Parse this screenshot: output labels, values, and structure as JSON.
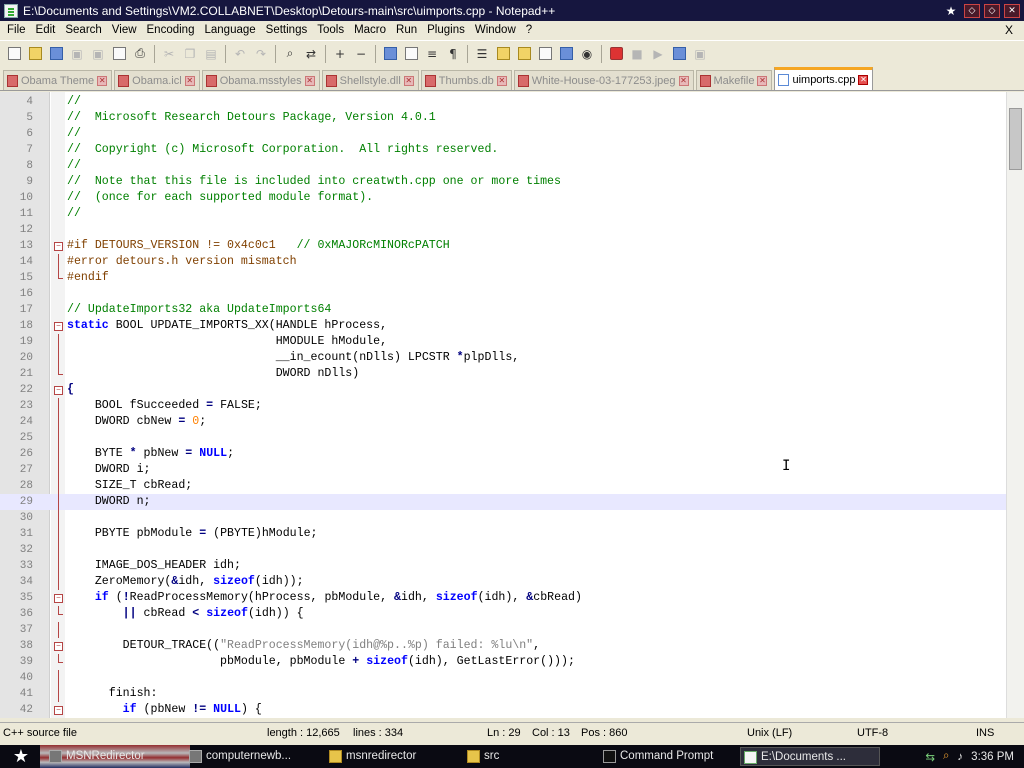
{
  "window": {
    "title": "E:\\Documents and Settings\\VM2.COLLABNET\\Desktop\\Detours-main\\src\\uimports.cpp - Notepad++",
    "controls": [
      "★",
      "◇",
      "◇",
      "✕"
    ]
  },
  "menu": [
    "File",
    "Edit",
    "Search",
    "View",
    "Encoding",
    "Language",
    "Settings",
    "Tools",
    "Macro",
    "Run",
    "Plugins",
    "Window",
    "?"
  ],
  "menu_close": "X",
  "tabs": [
    {
      "label": "Obama Theme",
      "active": false
    },
    {
      "label": "Obama.icl",
      "active": false
    },
    {
      "label": "Obama.msstyles",
      "active": false
    },
    {
      "label": "Shellstyle.dll",
      "active": false
    },
    {
      "label": "Thumbs.db",
      "active": false
    },
    {
      "label": "White-House-03-177253.jpeg",
      "active": false
    },
    {
      "label": "Makefile",
      "active": false
    },
    {
      "label": "uimports.cpp",
      "active": true
    }
  ],
  "status": {
    "file_type": "C++ source file",
    "length": "length : 12,665",
    "lines": "lines : 334",
    "ln": "Ln : 29",
    "col": "Col : 13",
    "pos": "Pos : 860",
    "eol": "Unix (LF)",
    "encoding": "UTF-8",
    "mode": "INS"
  },
  "taskbar": {
    "tasks": [
      {
        "label": "MSNRedirector",
        "icon": "browser"
      },
      {
        "label": "computernewb...",
        "icon": "browser"
      },
      {
        "label": "msnredirector",
        "icon": "folder"
      },
      {
        "label": "src",
        "icon": "folder"
      },
      {
        "label": "Command Prompt",
        "icon": "cmd"
      },
      {
        "label": "E:\\Documents ...",
        "icon": "np"
      }
    ],
    "clock": "3:36 PM"
  },
  "colors": {
    "comment": "#008000",
    "preprocessor": "#804000",
    "keyword": "#0000ff",
    "type": "#8000ff",
    "number": "#ff8000",
    "string": "#808080",
    "current_line": "#e8e8ff",
    "active_tab_accent": "#f5a623"
  },
  "editor": {
    "current_line": 29,
    "lines": [
      {
        "n": 4,
        "fold": "",
        "t": [
          [
            "c",
            "//"
          ]
        ]
      },
      {
        "n": 5,
        "fold": "",
        "t": [
          [
            "c",
            "//  Microsoft Research Detours Package, Version 4.0.1"
          ]
        ]
      },
      {
        "n": 6,
        "fold": "",
        "t": [
          [
            "c",
            "//"
          ]
        ]
      },
      {
        "n": 7,
        "fold": "",
        "t": [
          [
            "c",
            "//  Copyright (c) Microsoft Corporation.  All rights reserved."
          ]
        ]
      },
      {
        "n": 8,
        "fold": "",
        "t": [
          [
            "c",
            "//"
          ]
        ]
      },
      {
        "n": 9,
        "fold": "",
        "t": [
          [
            "c",
            "//  Note that this file is included into creatwth.cpp one or more times"
          ]
        ]
      },
      {
        "n": 10,
        "fold": "",
        "t": [
          [
            "c",
            "//  (once for each supported module format)."
          ]
        ]
      },
      {
        "n": 11,
        "fold": "",
        "t": [
          [
            "c",
            "//"
          ]
        ]
      },
      {
        "n": 12,
        "fold": "",
        "t": []
      },
      {
        "n": 13,
        "fold": "open",
        "t": [
          [
            "p",
            "#if DETOURS_VERSION != 0x4c0c1   "
          ],
          [
            "c",
            "// 0xMAJORcMINORcPATCH"
          ]
        ]
      },
      {
        "n": 14,
        "fold": "bar",
        "t": [
          [
            "p",
            "#error detours.h version mismatch"
          ]
        ]
      },
      {
        "n": 15,
        "fold": "end",
        "t": [
          [
            "p",
            "#endif"
          ]
        ]
      },
      {
        "n": 16,
        "fold": "",
        "t": []
      },
      {
        "n": 17,
        "fold": "",
        "t": [
          [
            "c",
            "// UpdateImports32 aka UpdateImports64"
          ]
        ]
      },
      {
        "n": 18,
        "fold": "open",
        "t": [
          [
            "k",
            "static"
          ],
          [
            "x",
            " BOOL UPDATE_IMPORTS_XX(HANDLE hProcess,"
          ]
        ]
      },
      {
        "n": 19,
        "fold": "bar",
        "t": [
          [
            "x",
            "                              HMODULE hModule,"
          ]
        ]
      },
      {
        "n": 20,
        "fold": "bar",
        "t": [
          [
            "x",
            "                              __in_ecount(nDlls) LPCSTR "
          ],
          [
            "o",
            "*"
          ],
          [
            "x",
            "plpDlls,"
          ]
        ]
      },
      {
        "n": 21,
        "fold": "end",
        "t": [
          [
            "x",
            "                              DWORD nDlls)"
          ]
        ]
      },
      {
        "n": 22,
        "fold": "open",
        "t": [
          [
            "o",
            "{"
          ]
        ]
      },
      {
        "n": 23,
        "fold": "bar",
        "t": [
          [
            "x",
            "    BOOL fSucceeded "
          ],
          [
            "o",
            "="
          ],
          [
            "x",
            " FALSE;"
          ]
        ]
      },
      {
        "n": 24,
        "fold": "bar",
        "t": [
          [
            "x",
            "    DWORD cbNew "
          ],
          [
            "o",
            "="
          ],
          [
            "x",
            " "
          ],
          [
            "n",
            "0"
          ],
          [
            "x",
            ";"
          ]
        ]
      },
      {
        "n": 25,
        "fold": "bar",
        "t": []
      },
      {
        "n": 26,
        "fold": "bar",
        "t": [
          [
            "x",
            "    BYTE "
          ],
          [
            "o",
            "*"
          ],
          [
            "x",
            " pbNew "
          ],
          [
            "o",
            "="
          ],
          [
            "x",
            " "
          ],
          [
            "k",
            "NULL"
          ],
          [
            "x",
            ";"
          ]
        ]
      },
      {
        "n": 27,
        "fold": "bar",
        "t": [
          [
            "x",
            "    DWORD i;"
          ]
        ]
      },
      {
        "n": 28,
        "fold": "bar",
        "t": [
          [
            "x",
            "    SIZE_T cbRead;"
          ]
        ]
      },
      {
        "n": 29,
        "fold": "bar",
        "t": [
          [
            "x",
            "    DWORD n;"
          ]
        ]
      },
      {
        "n": 30,
        "fold": "bar",
        "t": []
      },
      {
        "n": 31,
        "fold": "bar",
        "t": [
          [
            "x",
            "    PBYTE pbModule "
          ],
          [
            "o",
            "="
          ],
          [
            "x",
            " (PBYTE)hModule;"
          ]
        ]
      },
      {
        "n": 32,
        "fold": "bar",
        "t": []
      },
      {
        "n": 33,
        "fold": "bar",
        "t": [
          [
            "x",
            "    IMAGE_DOS_HEADER idh;"
          ]
        ]
      },
      {
        "n": 34,
        "fold": "bar",
        "t": [
          [
            "x",
            "    ZeroMemory("
          ],
          [
            "o",
            "&"
          ],
          [
            "x",
            "idh, "
          ],
          [
            "k",
            "sizeof"
          ],
          [
            "x",
            "(idh));"
          ]
        ]
      },
      {
        "n": 35,
        "fold": "open",
        "t": [
          [
            "x",
            "    "
          ],
          [
            "k",
            "if"
          ],
          [
            "x",
            " ("
          ],
          [
            "o",
            "!"
          ],
          [
            "x",
            "ReadProcessMemory(hProcess, pbModule, "
          ],
          [
            "o",
            "&"
          ],
          [
            "x",
            "idh, "
          ],
          [
            "k",
            "sizeof"
          ],
          [
            "x",
            "(idh), "
          ],
          [
            "o",
            "&"
          ],
          [
            "x",
            "cbRead)"
          ]
        ]
      },
      {
        "n": 36,
        "fold": "end",
        "t": [
          [
            "x",
            "        "
          ],
          [
            "o",
            "||"
          ],
          [
            "x",
            " cbRead "
          ],
          [
            "o",
            "<"
          ],
          [
            "x",
            " "
          ],
          [
            "k",
            "sizeof"
          ],
          [
            "x",
            "(idh)) {"
          ]
        ]
      },
      {
        "n": 37,
        "fold": "bar",
        "t": []
      },
      {
        "n": 38,
        "fold": "open",
        "t": [
          [
            "x",
            "        DETOUR_TRACE(("
          ],
          [
            "s",
            "\"ReadProcessMemory(idh@%p..%p) failed: %lu\\n\""
          ],
          [
            "x",
            ","
          ]
        ]
      },
      {
        "n": 39,
        "fold": "end",
        "t": [
          [
            "x",
            "                      pbModule, pbModule "
          ],
          [
            "o",
            "+"
          ],
          [
            "x",
            " "
          ],
          [
            "k",
            "sizeof"
          ],
          [
            "x",
            "(idh), GetLastError()));"
          ]
        ]
      },
      {
        "n": 40,
        "fold": "bar",
        "t": []
      },
      {
        "n": 41,
        "fold": "bar",
        "t": [
          [
            "x",
            "      finish:"
          ]
        ]
      },
      {
        "n": 42,
        "fold": "open",
        "t": [
          [
            "x",
            "        "
          ],
          [
            "k",
            "if"
          ],
          [
            "x",
            " (pbNew "
          ],
          [
            "o",
            "!="
          ],
          [
            "x",
            " "
          ],
          [
            "k",
            "NULL"
          ],
          [
            "x",
            ") {"
          ]
        ]
      }
    ]
  }
}
